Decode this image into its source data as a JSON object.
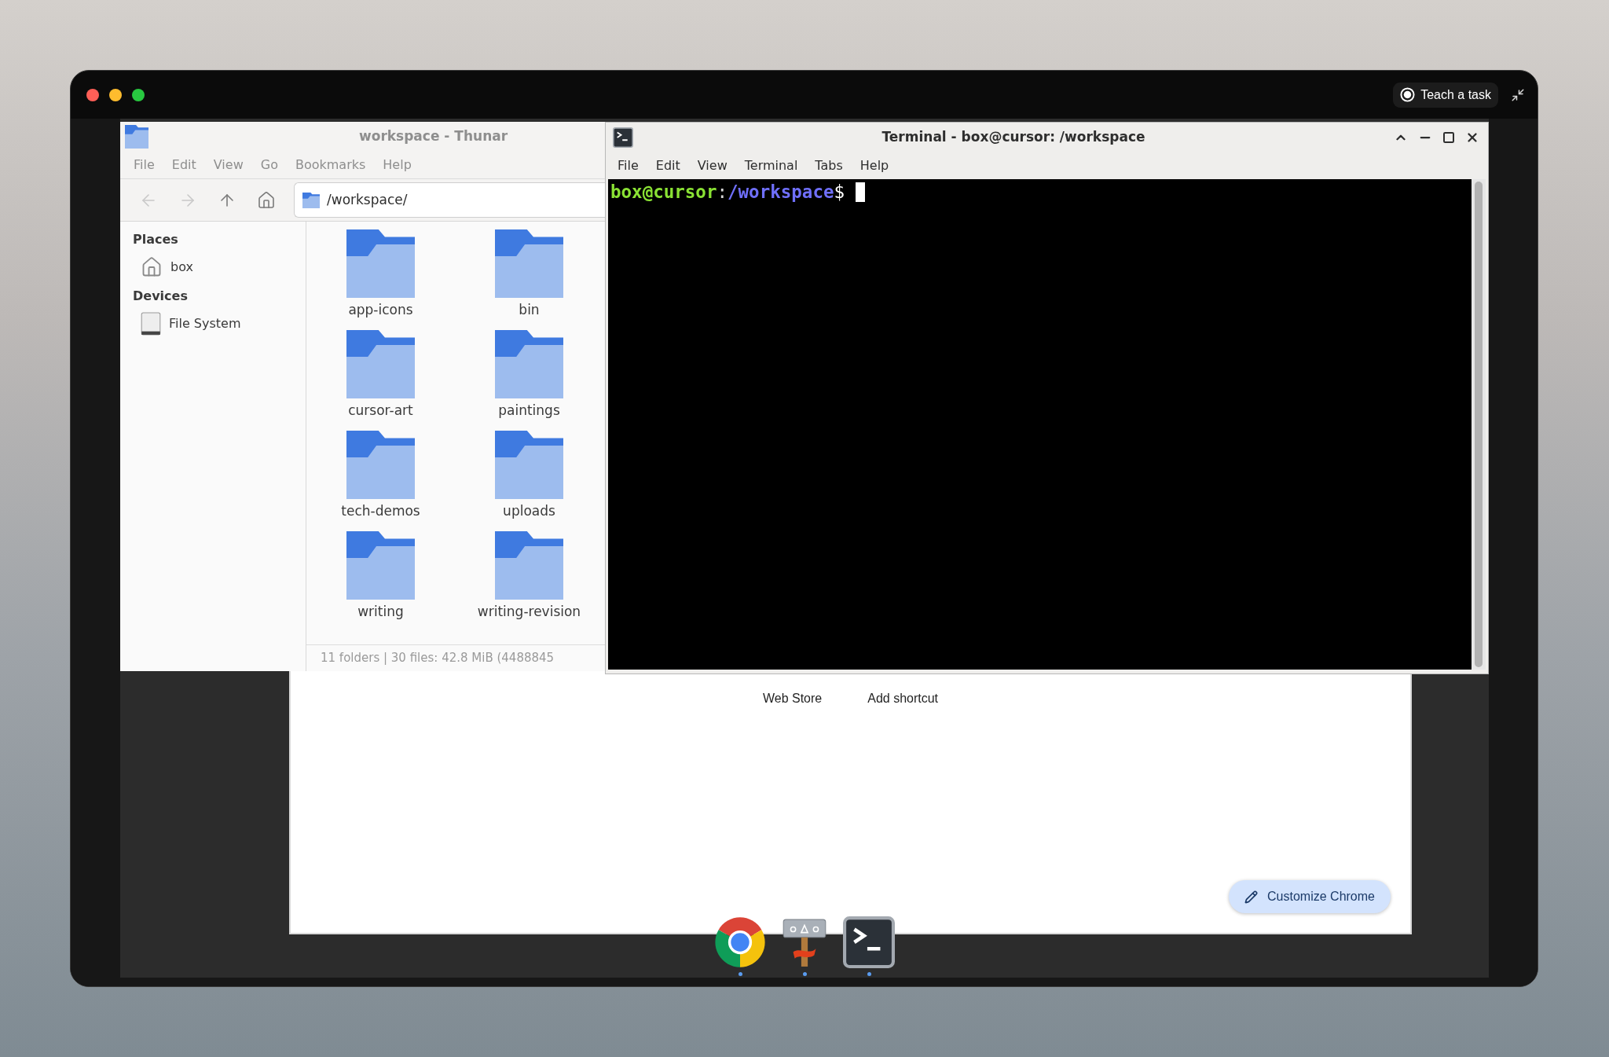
{
  "top_bar": {
    "teach_button": "Teach a task"
  },
  "thunar": {
    "active": false,
    "title": "workspace - Thunar",
    "menu": [
      "File",
      "Edit",
      "View",
      "Go",
      "Bookmarks",
      "Help"
    ],
    "toolbar": [
      {
        "kind": "back",
        "disabled": true
      },
      {
        "kind": "forward",
        "disabled": true
      },
      {
        "kind": "up",
        "disabled": false
      },
      {
        "kind": "home",
        "disabled": false
      }
    ],
    "location": "/workspace/",
    "sidebar": [
      {
        "heading": "Places",
        "items": [
          {
            "kind": "home",
            "label": "box"
          }
        ]
      },
      {
        "heading": "Devices",
        "items": [
          {
            "kind": "drive",
            "label": "File System"
          }
        ]
      }
    ],
    "folders": [
      "app-icons",
      "bin",
      "cursor-art",
      "paintings",
      "tech-demos",
      "uploads",
      "writing",
      "writing-revision"
    ],
    "status": "11 folders | 30 files: 42.8 MiB (4488845"
  },
  "terminal": {
    "active": true,
    "title": "Terminal - box@cursor: /workspace",
    "menu": [
      "File",
      "Edit",
      "View",
      "Terminal",
      "Tabs",
      "Help"
    ],
    "prompt": {
      "user_host": "box@cursor",
      "separator": ":",
      "path": "/workspace",
      "symbol": "$"
    }
  },
  "browser": {
    "shortcuts": [
      "Web Store",
      "Add shortcut"
    ],
    "customize_button": "Customize Chrome"
  },
  "dock": [
    {
      "kind": "browser",
      "running": true
    },
    {
      "kind": "signpost",
      "running": true
    },
    {
      "kind": "terminal",
      "running": true
    }
  ]
}
